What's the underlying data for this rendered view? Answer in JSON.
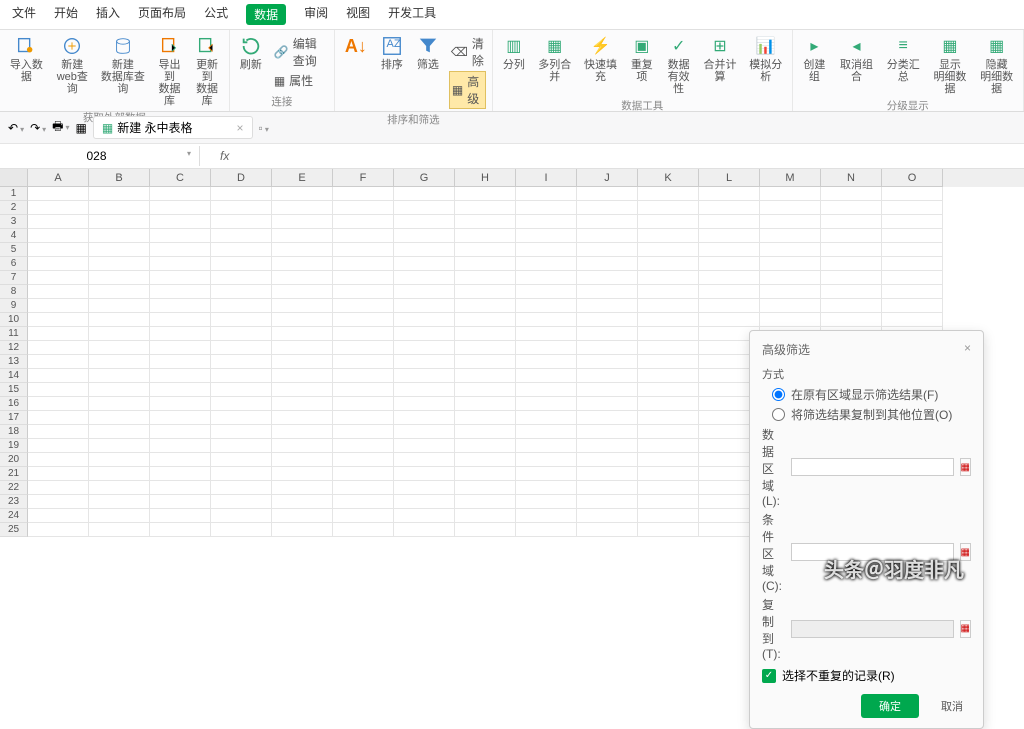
{
  "menu": {
    "items": [
      "文件",
      "开始",
      "插入",
      "页面布局",
      "公式",
      "数据",
      "审阅",
      "视图",
      "开发工具"
    ],
    "active": 5
  },
  "ribbon": {
    "group1": {
      "label": "获取外部数据",
      "btns": [
        "导入数据",
        "新建\nweb查询",
        "新建\n数据库查询",
        "导出到\n数据库",
        "更新到\n数据库"
      ]
    },
    "group2": {
      "label": "连接",
      "btn": "刷新",
      "mini": [
        "编辑查询",
        "属性"
      ]
    },
    "group3": {
      "label": "排序和筛选",
      "btns": [
        "排序",
        "筛选"
      ],
      "mini": [
        "清除",
        "高级"
      ]
    },
    "group4": {
      "label": "数据工具",
      "btns": [
        "分列",
        "多列合并",
        "快速填充",
        "重复项",
        "数据\n有效性",
        "合并计算",
        "模拟分析"
      ]
    },
    "group5": {
      "label": "分级显示",
      "btns": [
        "创建组",
        "取消组合",
        "分类汇总",
        "显示\n明细数据",
        "隐藏\n明细数据"
      ]
    }
  },
  "qat": {
    "doc": "新建 永中表格"
  },
  "addr": {
    "cell": "028",
    "fx": "fx"
  },
  "cols": [
    "A",
    "B",
    "C",
    "D",
    "E",
    "F",
    "G",
    "H",
    "I",
    "J",
    "K",
    "L",
    "M",
    "N",
    "O"
  ],
  "rows": 25,
  "dialog": {
    "title": "高级筛选",
    "section": "方式",
    "opt1": "在原有区域显示筛选结果(F)",
    "opt2": "将筛选结果复制到其他位置(O)",
    "f1": "数据区域(L):",
    "f2": "条件区域(C):",
    "f3": "复制到(T):",
    "chk": "选择不重复的记录(R)",
    "ok": "确定",
    "cancel": "取消"
  },
  "watermark": "头条＠羽度非凡"
}
